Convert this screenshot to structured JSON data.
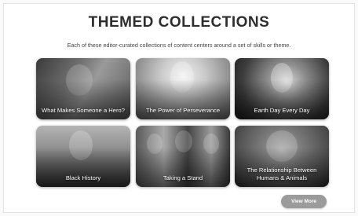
{
  "section": {
    "title": "THEMED COLLECTIONS",
    "subtitle": "Each of these editor-curated collections of content centers around a set of skills or theme."
  },
  "collections": [
    {
      "label": "What Makes Someone a Hero?"
    },
    {
      "label": "The Power of Perseverance"
    },
    {
      "label": "Earth Day Every Day"
    },
    {
      "label": "Black History"
    },
    {
      "label": "Taking a Stand"
    },
    {
      "label": "The Relationship Between Humans & Animals"
    }
  ],
  "actions": {
    "view_more_label": "View More"
  }
}
